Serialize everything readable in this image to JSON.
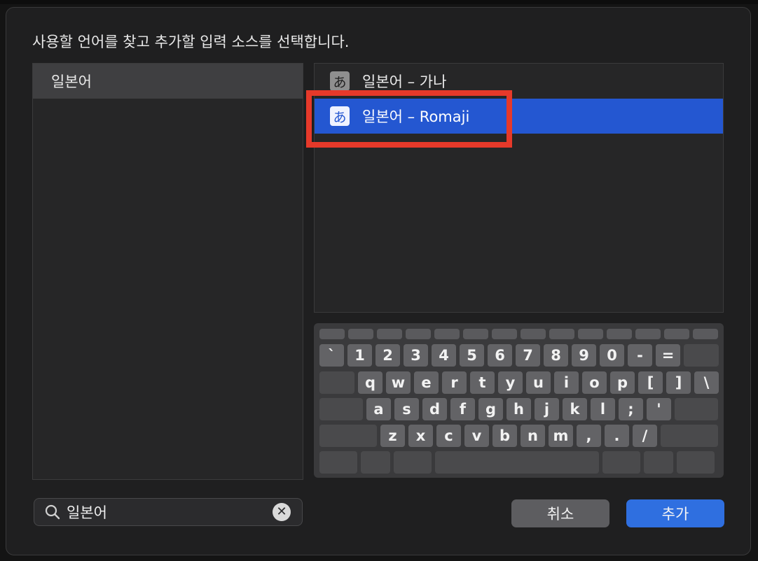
{
  "dialog": {
    "prompt": "사용할 언어를 찾고 추가할 입력 소스를 선택합니다."
  },
  "languages": [
    {
      "label": "일본어",
      "selected": true
    }
  ],
  "input_sources": [
    {
      "glyph": "あ",
      "label": "일본어 – 가나",
      "selected": false
    },
    {
      "glyph": "あ",
      "label": "일본어 – Romaji",
      "selected": true
    }
  ],
  "keyboard": {
    "row1": [
      "`",
      "1",
      "2",
      "3",
      "4",
      "5",
      "6",
      "7",
      "8",
      "9",
      "0",
      "-",
      "="
    ],
    "row2": [
      "q",
      "w",
      "e",
      "r",
      "t",
      "y",
      "u",
      "i",
      "o",
      "p",
      "[",
      "]",
      "\\"
    ],
    "row3": [
      "a",
      "s",
      "d",
      "f",
      "g",
      "h",
      "j",
      "k",
      "l",
      ";",
      "'"
    ],
    "row4": [
      "z",
      "x",
      "c",
      "v",
      "b",
      "n",
      "m",
      ",",
      ".",
      "/"
    ]
  },
  "search": {
    "value": "일본어",
    "icon": "search-icon",
    "clear_icon": "clear-icon"
  },
  "buttons": {
    "cancel": "취소",
    "add": "추가"
  },
  "colors": {
    "selection": "#2457d1",
    "highlight_box": "#e6392a",
    "add_button": "#2f6fe0"
  }
}
